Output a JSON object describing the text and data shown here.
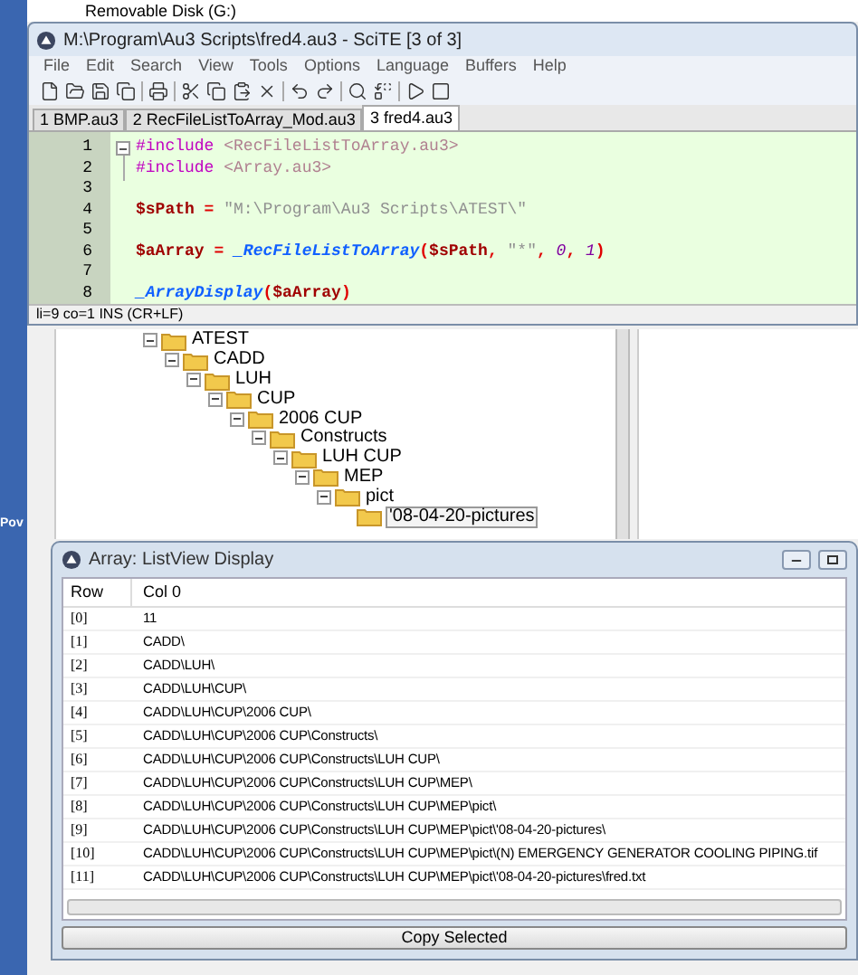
{
  "background_window": {
    "drive_item": "Removable Disk (G:)"
  },
  "desktop": {
    "icon_label": "Pov"
  },
  "editor_window": {
    "title": "M:\\Program\\Au3 Scripts\\fred4.au3 - SciTE [3 of 3]",
    "menu": [
      "File",
      "Edit",
      "Search",
      "View",
      "Tools",
      "Options",
      "Language",
      "Buffers",
      "Help"
    ],
    "tabs": [
      {
        "label": "1 BMP.au3",
        "selected": false
      },
      {
        "label": "2 RecFileListToArray_Mod.au3",
        "selected": false
      },
      {
        "label": "3 fred4.au3",
        "selected": true
      }
    ],
    "code_lines": [
      {
        "number": "1",
        "segments": [
          {
            "kind": "preprocessor",
            "text": "#include"
          },
          {
            "kind": "include",
            "text": " <RecFileListToArray.au3>"
          }
        ]
      },
      {
        "number": "2",
        "segments": [
          {
            "kind": "preprocessor",
            "text": "#include"
          },
          {
            "kind": "include",
            "text": " <Array.au3>"
          }
        ]
      },
      {
        "number": "3"
      },
      {
        "number": "4",
        "segments": [
          {
            "kind": "variable",
            "text": "$sPath"
          },
          {
            "kind": "operator",
            "text": " = "
          },
          {
            "kind": "string",
            "text": "\"M:\\Program\\Au3 Scripts\\ATEST\\\""
          }
        ]
      },
      {
        "number": "5"
      },
      {
        "number": "6",
        "segments": [
          {
            "kind": "variable",
            "text": "$aArray"
          },
          {
            "kind": "operator",
            "text": " = "
          },
          {
            "kind": "function",
            "text": "_RecFileListToArray"
          },
          {
            "kind": "operator",
            "text": "("
          },
          {
            "kind": "variable",
            "text": "$sPath"
          },
          {
            "kind": "operator",
            "text": ", "
          },
          {
            "kind": "string",
            "text": "\"*\""
          },
          {
            "kind": "operator",
            "text": ", "
          },
          {
            "kind": "number",
            "text": "0"
          },
          {
            "kind": "operator",
            "text": ", "
          },
          {
            "kind": "number",
            "text": "1"
          },
          {
            "kind": "operator",
            "text": ")"
          }
        ]
      },
      {
        "number": "7"
      },
      {
        "number": "8",
        "segments": [
          {
            "kind": "function",
            "text": "_ArrayDisplay"
          },
          {
            "kind": "operator",
            "text": "("
          },
          {
            "kind": "variable",
            "text": "$aArray"
          },
          {
            "kind": "operator",
            "text": ")"
          }
        ]
      }
    ],
    "status_bar": "li=9 co=1 INS (CR+LF)"
  },
  "folder_tree": [
    {
      "label": "ATEST",
      "expanded": true,
      "selected": false,
      "children": [
        {
          "label": "CADD",
          "expanded": true,
          "selected": false,
          "children": [
            {
              "label": "LUH",
              "expanded": true,
              "selected": false,
              "children": [
                {
                  "label": "CUP",
                  "expanded": true,
                  "selected": false,
                  "children": [
                    {
                      "label": "2006 CUP",
                      "expanded": true,
                      "selected": false,
                      "children": [
                        {
                          "label": "Constructs",
                          "expanded": true,
                          "selected": false,
                          "children": [
                            {
                              "label": "LUH CUP",
                              "expanded": true,
                              "selected": false,
                              "children": [
                                {
                                  "label": "MEP",
                                  "expanded": true,
                                  "selected": false,
                                  "children": [
                                    {
                                      "label": "pict",
                                      "expanded": true,
                                      "selected": false,
                                      "children": [
                                        {
                                          "label": "'08-04-20-pictures",
                                          "expanded": false,
                                          "selected": true
                                        }
                                      ]
                                    }
                                  ]
                                }
                              ]
                            }
                          ]
                        }
                      ]
                    }
                  ]
                }
              ]
            }
          ]
        }
      ]
    }
  ],
  "array_window": {
    "title": "Array: ListView Display",
    "columns": [
      "Row",
      "Col 0"
    ],
    "rows": [
      [
        "[0]",
        "11"
      ],
      [
        "[1]",
        "CADD\\"
      ],
      [
        "[2]",
        "CADD\\LUH\\"
      ],
      [
        "[3]",
        "CADD\\LUH\\CUP\\"
      ],
      [
        "[4]",
        "CADD\\LUH\\CUP\\2006 CUP\\"
      ],
      [
        "[5]",
        "CADD\\LUH\\CUP\\2006 CUP\\Constructs\\"
      ],
      [
        "[6]",
        "CADD\\LUH\\CUP\\2006 CUP\\Constructs\\LUH CUP\\"
      ],
      [
        "[7]",
        "CADD\\LUH\\CUP\\2006 CUP\\Constructs\\LUH CUP\\MEP\\"
      ],
      [
        "[8]",
        "CADD\\LUH\\CUP\\2006 CUP\\Constructs\\LUH CUP\\MEP\\pict\\"
      ],
      [
        "[9]",
        "CADD\\LUH\\CUP\\2006 CUP\\Constructs\\LUH CUP\\MEP\\pict\\'08-04-20-pictures\\"
      ],
      [
        "[10]",
        "CADD\\LUH\\CUP\\2006 CUP\\Constructs\\LUH CUP\\MEP\\pict\\(N) EMERGENCY GENERATOR COOLING PIPING.tif"
      ],
      [
        "[11]",
        "CADD\\LUH\\CUP\\2006 CUP\\Constructs\\LUH CUP\\MEP\\pict\\'08-04-20-pictures\\fred.txt"
      ]
    ],
    "button": "Copy Selected"
  }
}
